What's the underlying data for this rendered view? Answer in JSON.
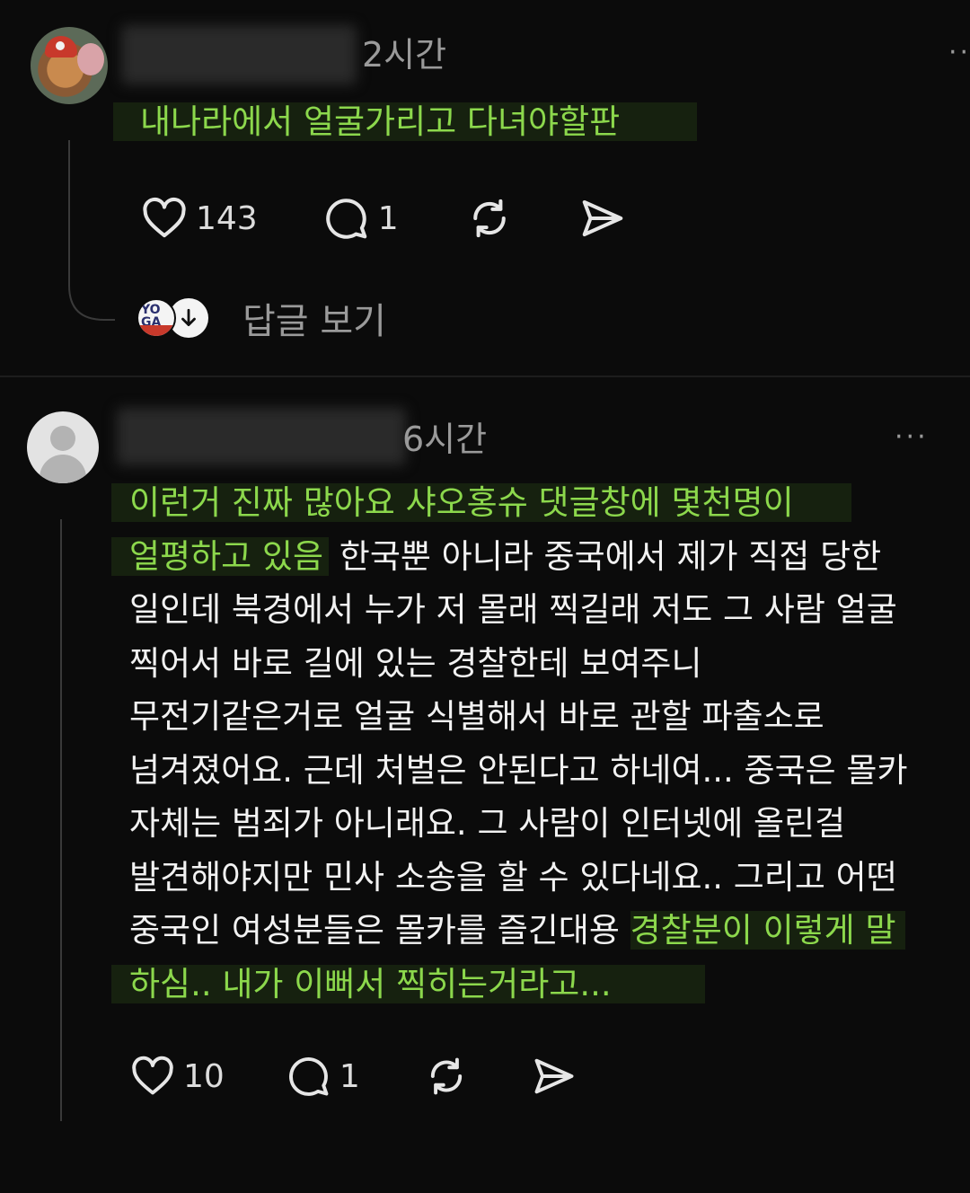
{
  "posts": [
    {
      "time": "2시간",
      "content_highlight": "내나라에서 얼굴가리고 다녀야할판",
      "likes": "143",
      "comments": "1",
      "icons": [
        "more-icon",
        "heart-icon",
        "comment-icon",
        "repost-icon",
        "share-icon"
      ],
      "reply": {
        "avatar_text": "YO\nGA",
        "label": "답글 보기"
      }
    },
    {
      "time": "6시간",
      "lines": [
        {
          "hl": "이런거 진짜 많아요 샤오홍슈 댓글창에 몇천명이",
          "text": ""
        },
        {
          "hl": "얼평하고 있음",
          "text": " 한국뿐 아니라 중국에서 제가 직접 당한"
        },
        {
          "hl": "",
          "text": "일인데 북경에서 누가 저 몰래 찍길래 저도 그 사람 얼굴"
        },
        {
          "hl": "",
          "text": "찍어서 바로 길에 있는 경찰한테 보여주니"
        },
        {
          "hl": "",
          "text": "무전기같은거로 얼굴 식별해서 바로 관할 파출소로"
        },
        {
          "hl": "",
          "text": "넘겨졌어요. 근데 처벌은 안된다고 하네여... 중국은 몰카"
        },
        {
          "hl": "",
          "text": "자체는 범죄가 아니래요. 그 사람이 인터넷에 올린걸"
        },
        {
          "hl": "",
          "text": "발견해야지만 민사 소송을 할 수 있다네요.. 그리고 어떤"
        },
        {
          "text": "중국인 여성분들은 몰카를 즐긴대용 ",
          "hl_end": "경찰분이 이렇게 말"
        },
        {
          "hl": "하심.. 내가 이뻐서 찍히는거라고...",
          "text": ""
        }
      ],
      "likes": "10",
      "comments": "1"
    }
  ],
  "colors": {
    "background": "#0b0b0b",
    "highlight_text": "#8cd84c",
    "highlight_bg": "#16210f",
    "muted": "#9a9a9a"
  }
}
